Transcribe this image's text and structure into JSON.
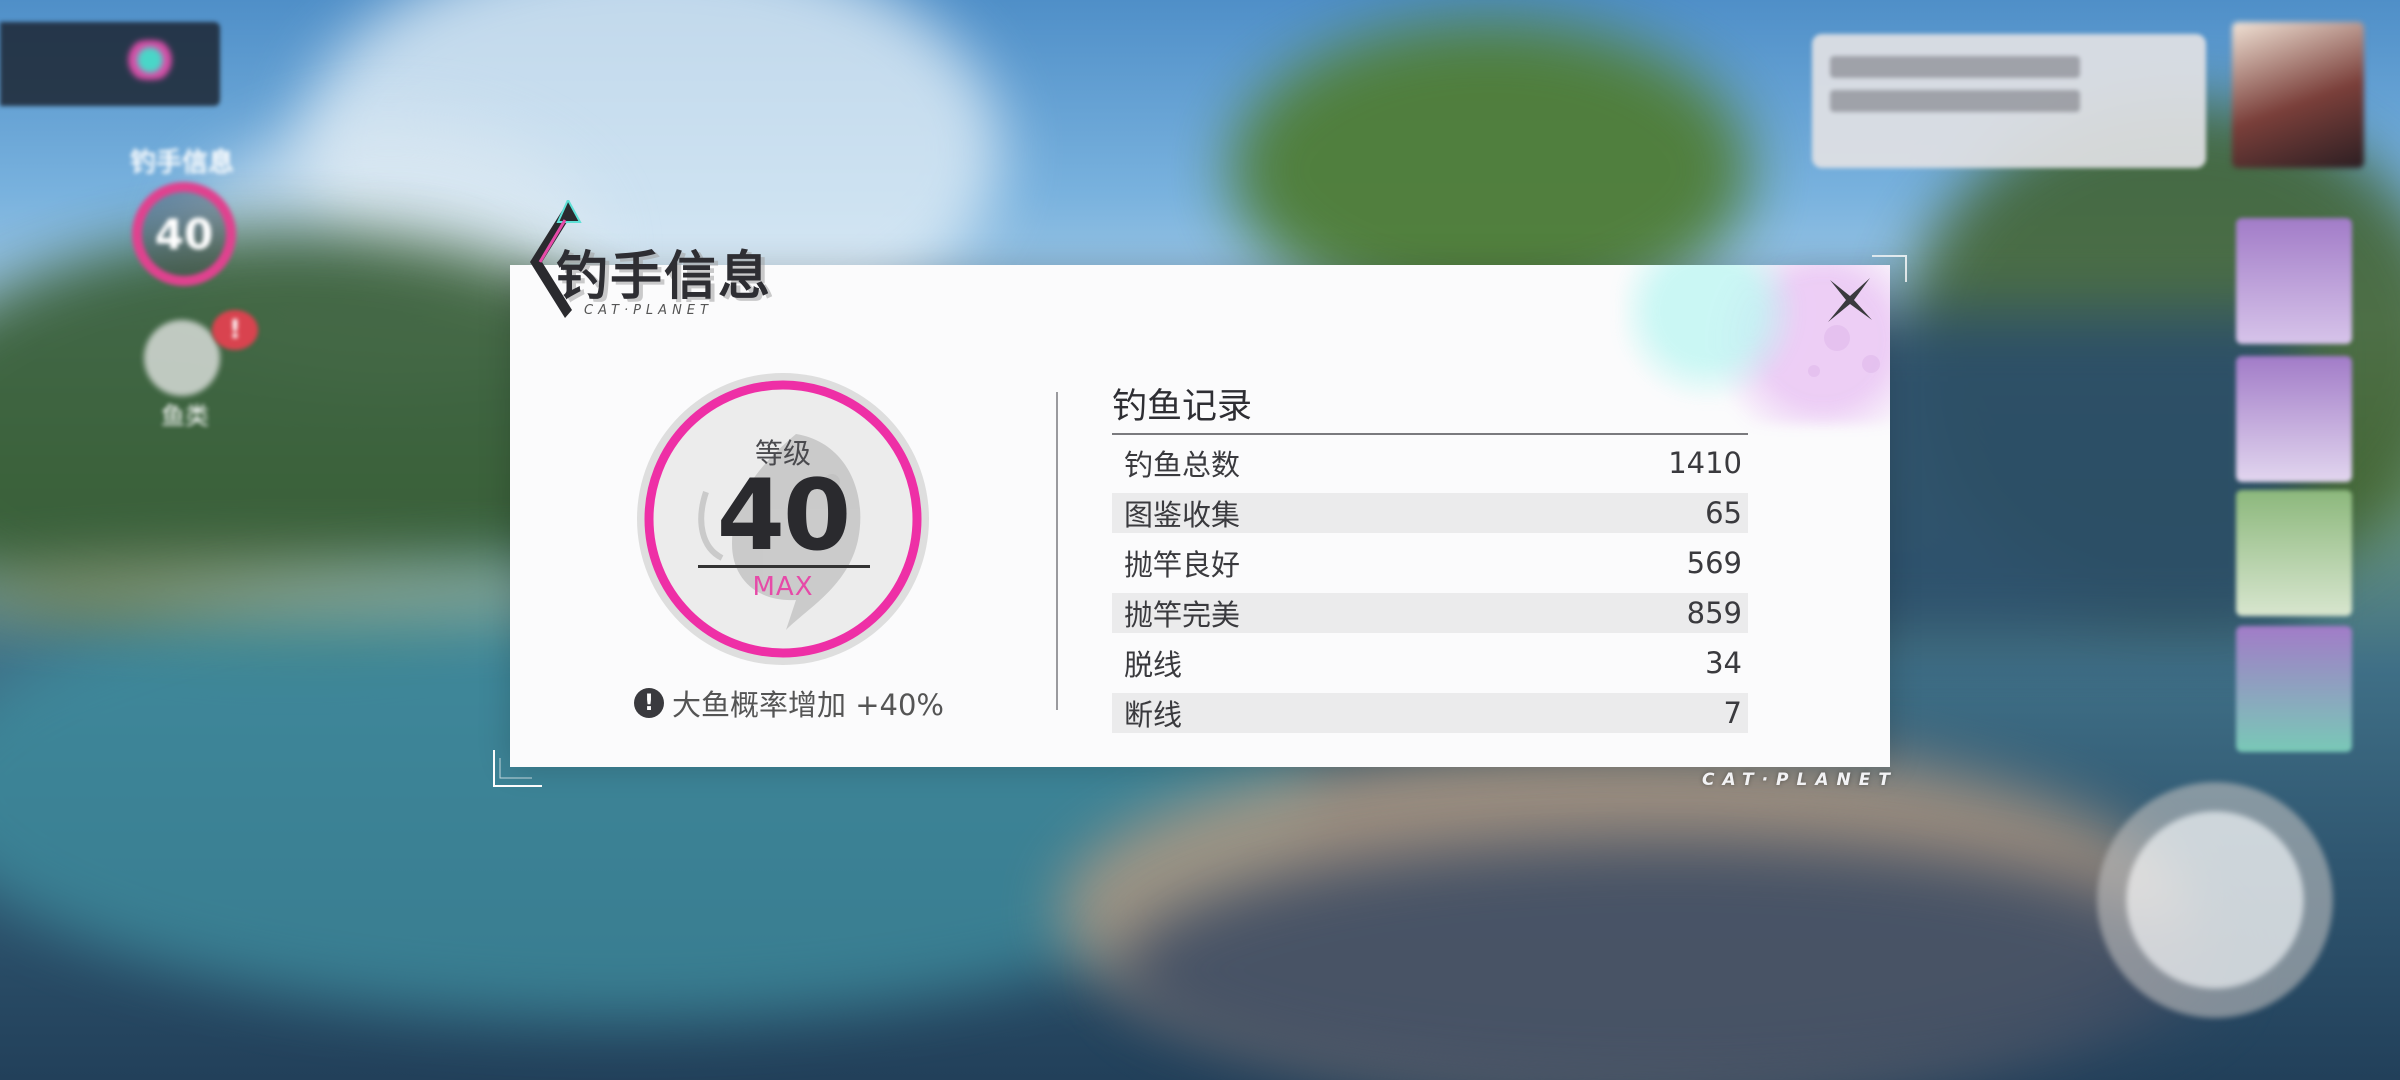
{
  "dialog": {
    "title": "钓手信息",
    "brand_small": "CAT·PLANET",
    "brand_bottom": "CAT·PLANET",
    "close_icon": "close-icon"
  },
  "level": {
    "label": "等级",
    "value": "40",
    "status": "MAX",
    "ring_color": "#ee2fa6"
  },
  "bonus": {
    "icon": "alert-icon",
    "text": "大鱼概率增加 +40%"
  },
  "records": {
    "title": "钓鱼记录",
    "rows": [
      {
        "label": "钓鱼总数",
        "value": "1410"
      },
      {
        "label": "图鉴收集",
        "value": "65"
      },
      {
        "label": "抛竿良好",
        "value": "569"
      },
      {
        "label": "抛竿完美",
        "value": "859"
      },
      {
        "label": "脱线",
        "value": "34"
      },
      {
        "label": "断线",
        "value": "7"
      }
    ]
  },
  "hud": {
    "level_label": "钓手信息",
    "level_value": "40",
    "badge": "!",
    "fish_label": "鱼类"
  },
  "colors": {
    "accent": "#ee2fa6",
    "dialog_bg": "#fbfbfc",
    "row_alt": "#ebebec"
  }
}
